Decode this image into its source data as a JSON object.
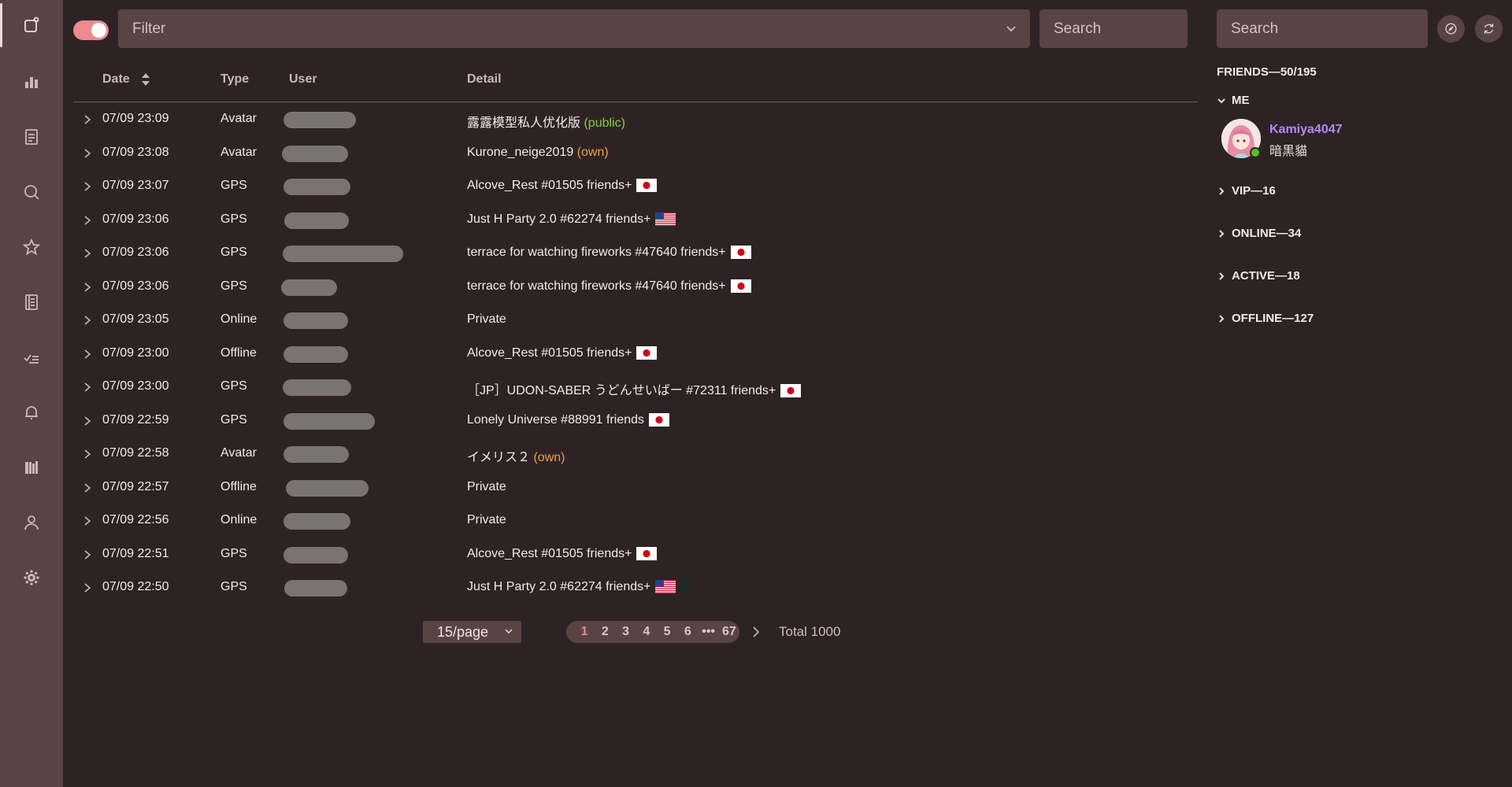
{
  "topbar": {
    "filter_placeholder": "Filter",
    "search_placeholder": "Search",
    "side_search_placeholder": "Search"
  },
  "table": {
    "columns": {
      "date": "Date",
      "type": "Type",
      "user": "User",
      "detail": "Detail"
    },
    "rows": [
      {
        "date": "07/09 23:09",
        "type": "Avatar",
        "detail": "露露模型私人优化版",
        "tag": "(public)",
        "tag_color": "green",
        "flag": ""
      },
      {
        "date": "07/09 23:08",
        "type": "Avatar",
        "detail": "Kurone_neige2019",
        "tag": "(own)",
        "tag_color": "orange",
        "flag": ""
      },
      {
        "date": "07/09 23:07",
        "type": "GPS",
        "detail": "Alcove_Rest #01505 friends+",
        "tag": "",
        "tag_color": "",
        "flag": "jp"
      },
      {
        "date": "07/09 23:06",
        "type": "GPS",
        "detail": "Just H Party 2.0 #62274 friends+",
        "tag": "",
        "tag_color": "",
        "flag": "us"
      },
      {
        "date": "07/09 23:06",
        "type": "GPS",
        "detail": "terrace for watching fireworks #47640 friends+",
        "tag": "",
        "tag_color": "",
        "flag": "jp"
      },
      {
        "date": "07/09 23:06",
        "type": "GPS",
        "detail": "terrace for watching fireworks #47640 friends+",
        "tag": "",
        "tag_color": "",
        "flag": "jp"
      },
      {
        "date": "07/09 23:05",
        "type": "Online",
        "detail": "Private",
        "tag": "",
        "tag_color": "",
        "flag": ""
      },
      {
        "date": "07/09 23:00",
        "type": "Offline",
        "detail": "Alcove_Rest #01505 friends+",
        "tag": "",
        "tag_color": "",
        "flag": "jp"
      },
      {
        "date": "07/09 23:00",
        "type": "GPS",
        "detail": "［JP］UDON-SABER うどんせいばー #72311 friends+",
        "tag": "",
        "tag_color": "",
        "flag": "jp"
      },
      {
        "date": "07/09 22:59",
        "type": "GPS",
        "detail": "Lonely Universe #88991 friends",
        "tag": "",
        "tag_color": "",
        "flag": "jp"
      },
      {
        "date": "07/09 22:58",
        "type": "Avatar",
        "detail": "イメリス２",
        "tag": "(own)",
        "tag_color": "orange",
        "flag": ""
      },
      {
        "date": "07/09 22:57",
        "type": "Offline",
        "detail": "Private",
        "tag": "",
        "tag_color": "",
        "flag": ""
      },
      {
        "date": "07/09 22:56",
        "type": "Online",
        "detail": "Private",
        "tag": "",
        "tag_color": "",
        "flag": ""
      },
      {
        "date": "07/09 22:51",
        "type": "GPS",
        "detail": "Alcove_Rest #01505 friends+",
        "tag": "",
        "tag_color": "",
        "flag": "jp"
      },
      {
        "date": "07/09 22:50",
        "type": "GPS",
        "detail": "Just H Party 2.0 #62274 friends+",
        "tag": "",
        "tag_color": "",
        "flag": "us"
      }
    ]
  },
  "pagination": {
    "per_page": "15/page",
    "pages": [
      "1",
      "2",
      "3",
      "4",
      "5",
      "6",
      "•••",
      "67"
    ],
    "current": "1",
    "total": "Total 1000"
  },
  "friends": {
    "title": "FRIENDS—50/195",
    "me_label": "ME",
    "me": {
      "name": "Kamiya4047",
      "status": "暗黒貓"
    },
    "groups": [
      "VIP—16",
      "ONLINE—34",
      "ACTIVE—18",
      "OFFLINE—127"
    ]
  },
  "colors": {
    "background": "#2e2324",
    "nav": "#5b4244",
    "input": "#5a4345",
    "accent": "#ec8a8f",
    "public_tag": "#7dd14b",
    "own_tag": "#e9a24a",
    "username": "#b887ff",
    "online_dot": "#52c41a"
  },
  "icons": {
    "nav": [
      "feed-icon",
      "chart-icon",
      "notes-icon",
      "search-icon",
      "star-icon",
      "document-icon",
      "checklist-icon",
      "bell-icon",
      "library-icon",
      "user-icon",
      "gear-icon"
    ],
    "top": [
      "compass-icon",
      "refresh-icon"
    ]
  }
}
